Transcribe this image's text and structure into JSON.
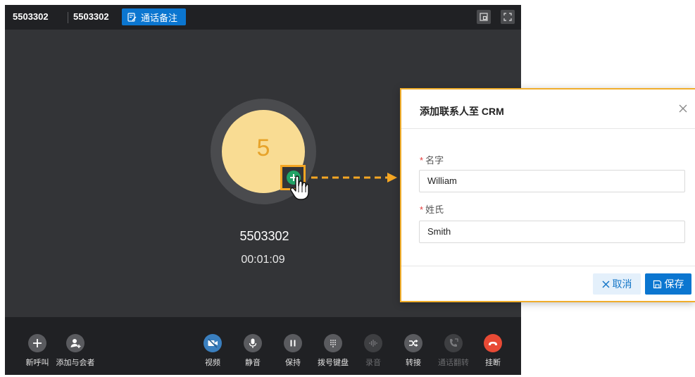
{
  "topbar": {
    "number_left": "5503302",
    "number_right": "5503302",
    "call_note_label": "通话备注",
    "icons": [
      "note-icon",
      "pip-icon",
      "fullscreen-icon"
    ]
  },
  "call": {
    "avatar_initial": "5",
    "caller_number": "5503302",
    "duration": "00:01:09",
    "add_contact_icon": "add-contact-icon"
  },
  "controls_left": [
    {
      "label": "新呼叫",
      "icon": "plus-icon"
    },
    {
      "label": "添加与会者",
      "icon": "add-person-icon"
    }
  ],
  "controls_right": [
    {
      "label": "视频",
      "icon": "video-off-icon"
    },
    {
      "label": "静音",
      "icon": "mic-icon"
    },
    {
      "label": "保持",
      "icon": "pause-icon"
    },
    {
      "label": "拨号键盘",
      "icon": "dialpad-icon"
    },
    {
      "label": "录音",
      "icon": "waveform-icon",
      "disabled": true
    },
    {
      "label": "转接",
      "icon": "transfer-icon"
    },
    {
      "label": "通话翻转",
      "icon": "flip-call-icon",
      "disabled": true
    },
    {
      "label": "挂断",
      "icon": "hangup-icon"
    }
  ],
  "dialog": {
    "title": "添加联系人至 CRM",
    "fields": [
      {
        "label": "名字",
        "required": true,
        "value": "William"
      },
      {
        "label": "姓氏",
        "required": true,
        "value": "Smith"
      }
    ],
    "cancel_label": "取消",
    "save_label": "保存"
  },
  "colors": {
    "accent_blue": "#0b76d0",
    "highlight_orange": "#f5a623",
    "hangup_red": "#e84a35",
    "avatar_bg": "#f9dc93",
    "avatar_text": "#e7a32a"
  }
}
